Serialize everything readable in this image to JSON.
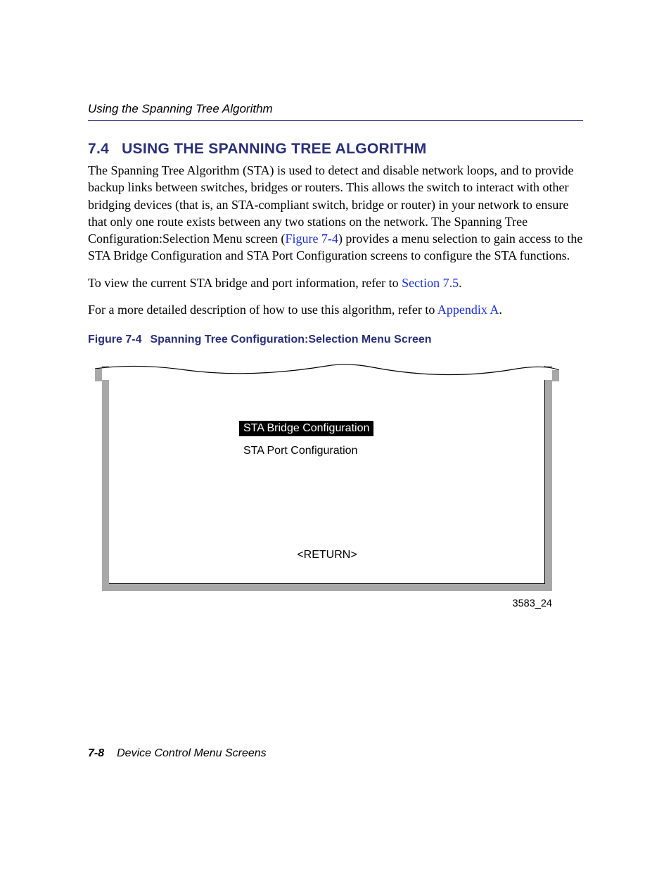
{
  "header": {
    "running": "Using the Spanning Tree Algorithm"
  },
  "section": {
    "number": "7.4",
    "title": "USING THE SPANNING TREE ALGORITHM"
  },
  "paragraphs": {
    "p1_a": "The Spanning Tree Algorithm (STA) is used to detect and disable network loops, and to provide backup links between switches, bridges or routers. This allows the switch to interact with other bridging devices (that is, an STA-compliant switch, bridge or router) in your network to ensure that only one route exists between any two stations on the network. The Spanning Tree Configuration:Selection Menu screen (",
    "p1_link": "Figure 7-4",
    "p1_b": ") provides a menu selection to gain access to the STA Bridge Configuration and STA Port Configuration screens to configure the STA functions.",
    "p2_a": "To view the current STA bridge and port information, refer to ",
    "p2_link": "Section 7.5",
    "p2_b": ".",
    "p3_a": "For a more detailed description of how to use this algorithm, refer to ",
    "p3_link": "Appendix A",
    "p3_b": "."
  },
  "figure": {
    "label": "Figure 7-4",
    "title": "Spanning Tree Configuration:Selection Menu Screen",
    "menu_selected": "STA Bridge Configuration",
    "menu_plain": "STA Port Configuration",
    "return": "<RETURN>",
    "id": "3583_24"
  },
  "footer": {
    "page": "7-8",
    "chapter": "Device Control Menu Screens"
  }
}
